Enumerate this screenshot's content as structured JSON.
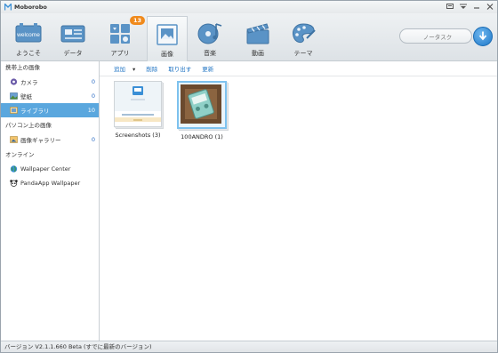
{
  "app": {
    "title": "Moborobo"
  },
  "toolbar": {
    "items": [
      {
        "label": "ようこそ",
        "icon": "welcome-icon",
        "icon_text": "welcome"
      },
      {
        "label": "データ",
        "icon": "data-icon"
      },
      {
        "label": "アプリ",
        "icon": "apps-icon",
        "badge": "13"
      },
      {
        "label": "画像",
        "icon": "images-icon",
        "active": true
      },
      {
        "label": "音楽",
        "icon": "music-icon"
      },
      {
        "label": "動画",
        "icon": "video-icon"
      },
      {
        "label": "テーマ",
        "icon": "theme-icon"
      }
    ],
    "search_placeholder": "ノータスク"
  },
  "sidebar": {
    "device_header": "携帯上の画像",
    "device_items": [
      {
        "label": "カメラ",
        "count": "0",
        "icon": "camera-icon"
      },
      {
        "label": "壁紙",
        "count": "0",
        "icon": "wallpaper-icon"
      },
      {
        "label": "ライブラリ",
        "count": "10",
        "icon": "library-icon",
        "selected": true
      }
    ],
    "pc_header": "パソコン上の画像",
    "pc_items": [
      {
        "label": "画像ギャラリー",
        "count": "0",
        "icon": "gallery-icon"
      }
    ],
    "online_header": "オンライン",
    "online_items": [
      {
        "label": "Wallpaper Center",
        "icon": "globe-icon"
      },
      {
        "label": "PandaApp Wallpaper",
        "icon": "panda-icon"
      }
    ]
  },
  "actions": {
    "add": "追加",
    "delete": "削除",
    "export": "取り出す",
    "refresh": "更新"
  },
  "albums": [
    {
      "name": "Screenshots (3)"
    },
    {
      "name": "100ANDRO (1)"
    }
  ],
  "status": {
    "text": "バージョン V2.1.1.660 Beta (すでに最新のバージョン)"
  },
  "colors": {
    "accent": "#5aa7de",
    "link": "#1e73c3",
    "badge": "#f08a1c"
  }
}
